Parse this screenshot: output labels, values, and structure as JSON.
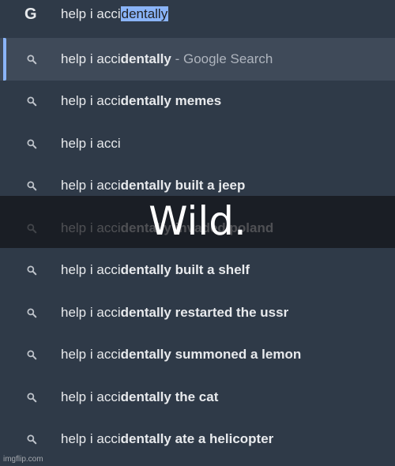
{
  "omnibox": {
    "icon": "google-g-icon",
    "icon_glyph": "G",
    "query_typed": "help i acci",
    "query_autocomplete": "dentally"
  },
  "suggestions": [
    {
      "prefix": "help i acci",
      "bold": "dentally",
      "suffix": " - Google Search",
      "icon": "search-icon"
    },
    {
      "prefix": "help i acci",
      "bold": "dentally memes",
      "suffix": "",
      "icon": "search-icon"
    },
    {
      "prefix": "help i acci",
      "bold": "",
      "suffix": "",
      "icon": "search-icon"
    },
    {
      "prefix": "help i acci",
      "bold": "dentally built a jeep",
      "suffix": "",
      "icon": "search-icon"
    },
    {
      "prefix": "help i acci",
      "bold": "dentally invaded poland",
      "suffix": "",
      "icon": "search-icon"
    },
    {
      "prefix": "help i acci",
      "bold": "dentally built a shelf",
      "suffix": "",
      "icon": "search-icon"
    },
    {
      "prefix": "help i acci",
      "bold": "dentally restarted the ussr",
      "suffix": "",
      "icon": "search-icon"
    },
    {
      "prefix": "help i acci",
      "bold": "dentally summoned a lemon",
      "suffix": "",
      "icon": "search-icon"
    },
    {
      "prefix": "help i acci",
      "bold": "dentally the cat",
      "suffix": "",
      "icon": "search-icon"
    },
    {
      "prefix": "help i acci",
      "bold": "dentally ate a helicopter",
      "suffix": "",
      "icon": "search-icon"
    }
  ],
  "overlay": {
    "caption": "Wild."
  },
  "watermark": "imgflip.com",
  "colors": {
    "background": "#2f3a48",
    "selected_row": "#3f4a59",
    "accent": "#8ab4f8",
    "text": "#e8eaed"
  }
}
